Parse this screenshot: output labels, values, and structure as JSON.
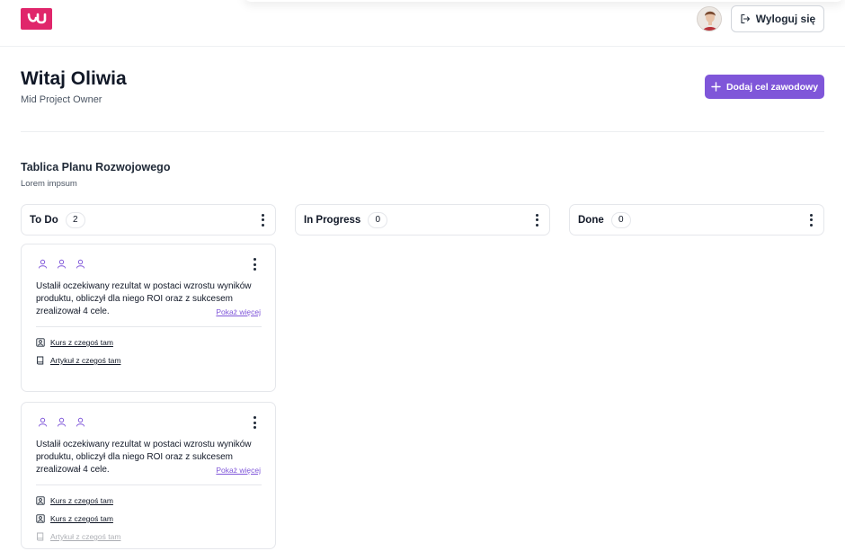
{
  "header": {
    "logo_text": "JU",
    "logout_label": "Wyloguj się"
  },
  "welcome": {
    "title": "Witaj Oliwia",
    "role": "Mid Project Owner",
    "add_goal_label": "Dodaj cel zawodowy"
  },
  "board": {
    "title": "Tablica Planu Rozwojowego",
    "subtitle": "Lorem impsum",
    "columns": [
      {
        "title": "To Do",
        "count": "2"
      },
      {
        "title": "In Progress",
        "count": "0"
      },
      {
        "title": "Done",
        "count": "0"
      }
    ],
    "cards": [
      {
        "text": "Ustalił oczekiwany rezultat w postaci wzrostu wyników produktu, obliczył dla niego ROI oraz z sukcesem zrealizował 4 cele.",
        "show_more": "Pokaż więcej",
        "resources": [
          {
            "icon": "course-icon",
            "label": "Kurs z czegoś tam"
          },
          {
            "icon": "book-icon",
            "label": "Artykuł z czegoś tam"
          }
        ]
      },
      {
        "text": "Ustalił oczekiwany rezultat w postaci wzrostu wyników produktu, obliczył dla niego ROI oraz z sukcesem zrealizował 4 cele.",
        "show_more": "Pokaż więcej",
        "resources": [
          {
            "icon": "course-icon",
            "label": "Kurs z czegoś tam"
          },
          {
            "icon": "course-icon",
            "label": "Kurs z czegoś tam"
          },
          {
            "icon": "book-icon",
            "label": "Artykuł z czegoś tam"
          }
        ]
      }
    ]
  },
  "colors": {
    "brand": "#e0266b",
    "accent": "#7f56d9"
  }
}
